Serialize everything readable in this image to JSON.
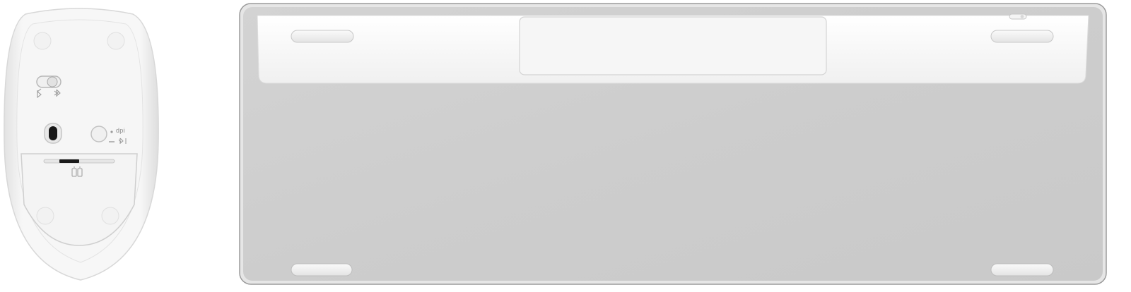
{
  "scene": {
    "background": "#ffffff"
  },
  "mouse": {
    "body_color": "#f4f4f4",
    "edge_color": "#d6d6d6",
    "dpi_label": "dpi",
    "mode_switch_icons": [
      "bluetooth-off-icon",
      "bluetooth-icon"
    ],
    "battery_icon": "battery-icon"
  },
  "keyboard": {
    "plate_color": "#cfcfcf",
    "frame_color": "#e8e8e8",
    "top_strip_color": "#f5f5f5",
    "feet_color": "#f3f3f3"
  }
}
